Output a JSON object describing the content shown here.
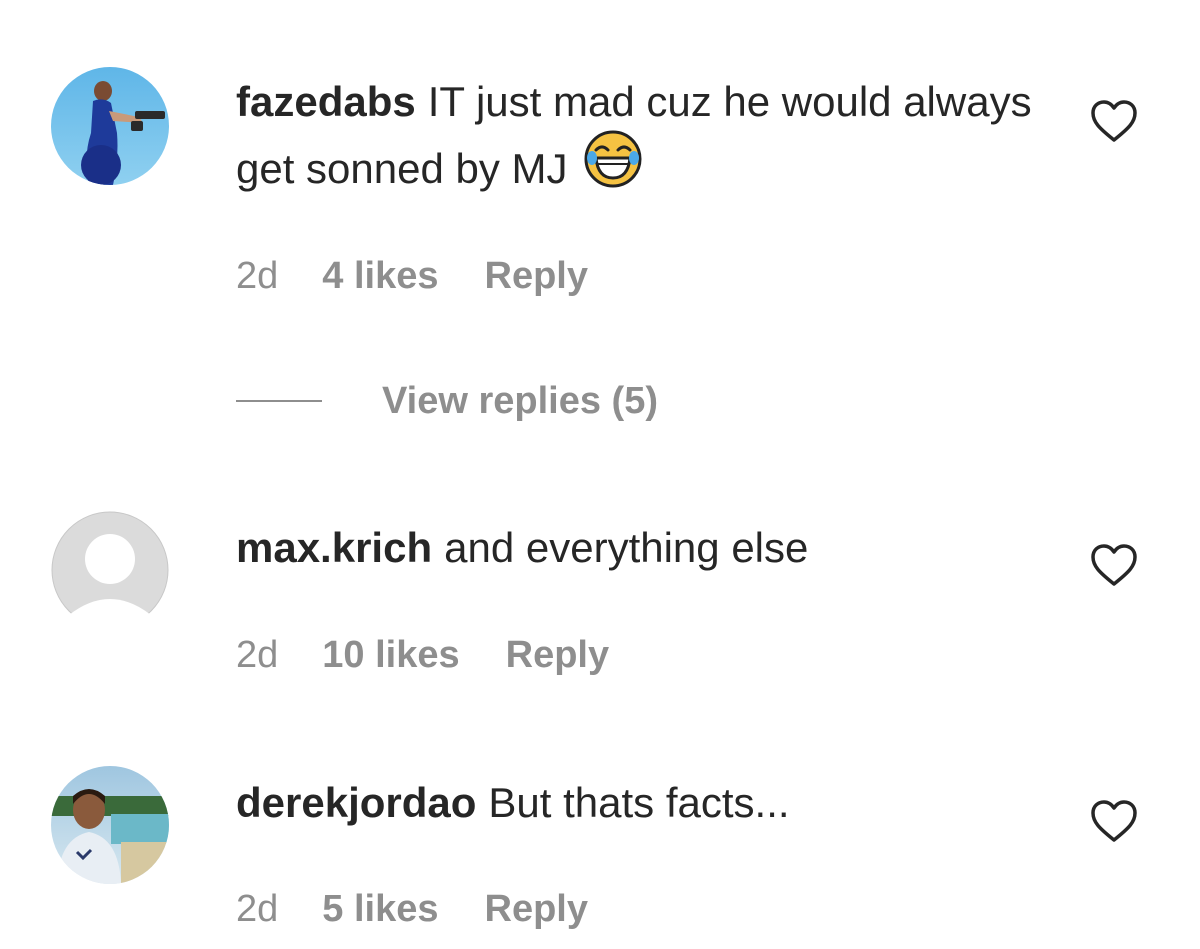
{
  "comments": [
    {
      "username": "fazedabs",
      "text": "IT just mad cuz he would always get sonned by MJ",
      "emoji": "face-with-tears-of-joy",
      "time": "2d",
      "likes": "4 likes",
      "reply": "Reply",
      "view_replies": "View replies (5)"
    },
    {
      "username": "max.krich",
      "text": "and everything else",
      "time": "2d",
      "likes": "10 likes",
      "reply": "Reply"
    },
    {
      "username": "derekjordao",
      "text": "But thats facts...",
      "time": "2d",
      "likes": "5 likes",
      "reply": "Reply"
    }
  ],
  "colors": {
    "text": "#262626",
    "secondary": "#8e8e8e",
    "background": "#ffffff"
  },
  "icons": [
    "heart-icon",
    "avatar",
    "laughing-emoji-icon"
  ]
}
